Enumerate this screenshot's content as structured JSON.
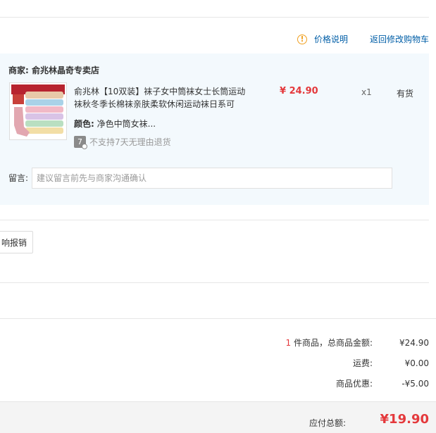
{
  "header": {
    "price_note": "价格说明",
    "return_cart": "返回修改购物车"
  },
  "shop": {
    "merchant_label": "商家:",
    "merchant_name": "俞兆林晶奇专卖店"
  },
  "product": {
    "title": "俞兆林【10双装】袜子女中筒袜女士长筒运动袜秋冬季长棉袜亲肤柔软休闲运动袜日系可",
    "price": "¥ 24.90",
    "quantity": "x1",
    "stock": "有货",
    "color_label": "颜色:",
    "color_value": "净色中筒女袜...",
    "return_policy": "不支持7天无理由退货",
    "return_icon": "7"
  },
  "message": {
    "label": "留言:",
    "placeholder": "建议留言前先与商家沟通确认"
  },
  "invoice": {
    "button_label": "响报销"
  },
  "summary": {
    "count": "1",
    "count_suffix": " 件商品，总商品金额:",
    "subtotal": "¥24.90",
    "shipping_label": "运费:",
    "shipping": "¥0.00",
    "discount_label": "商品优惠:",
    "discount": "-¥5.00",
    "total_label": "应付总额:",
    "total": "¥19.90"
  },
  "colors": {
    "accent_red": "#e4393c",
    "link_blue": "#005ea7",
    "box_bg": "#f3f9fd"
  }
}
